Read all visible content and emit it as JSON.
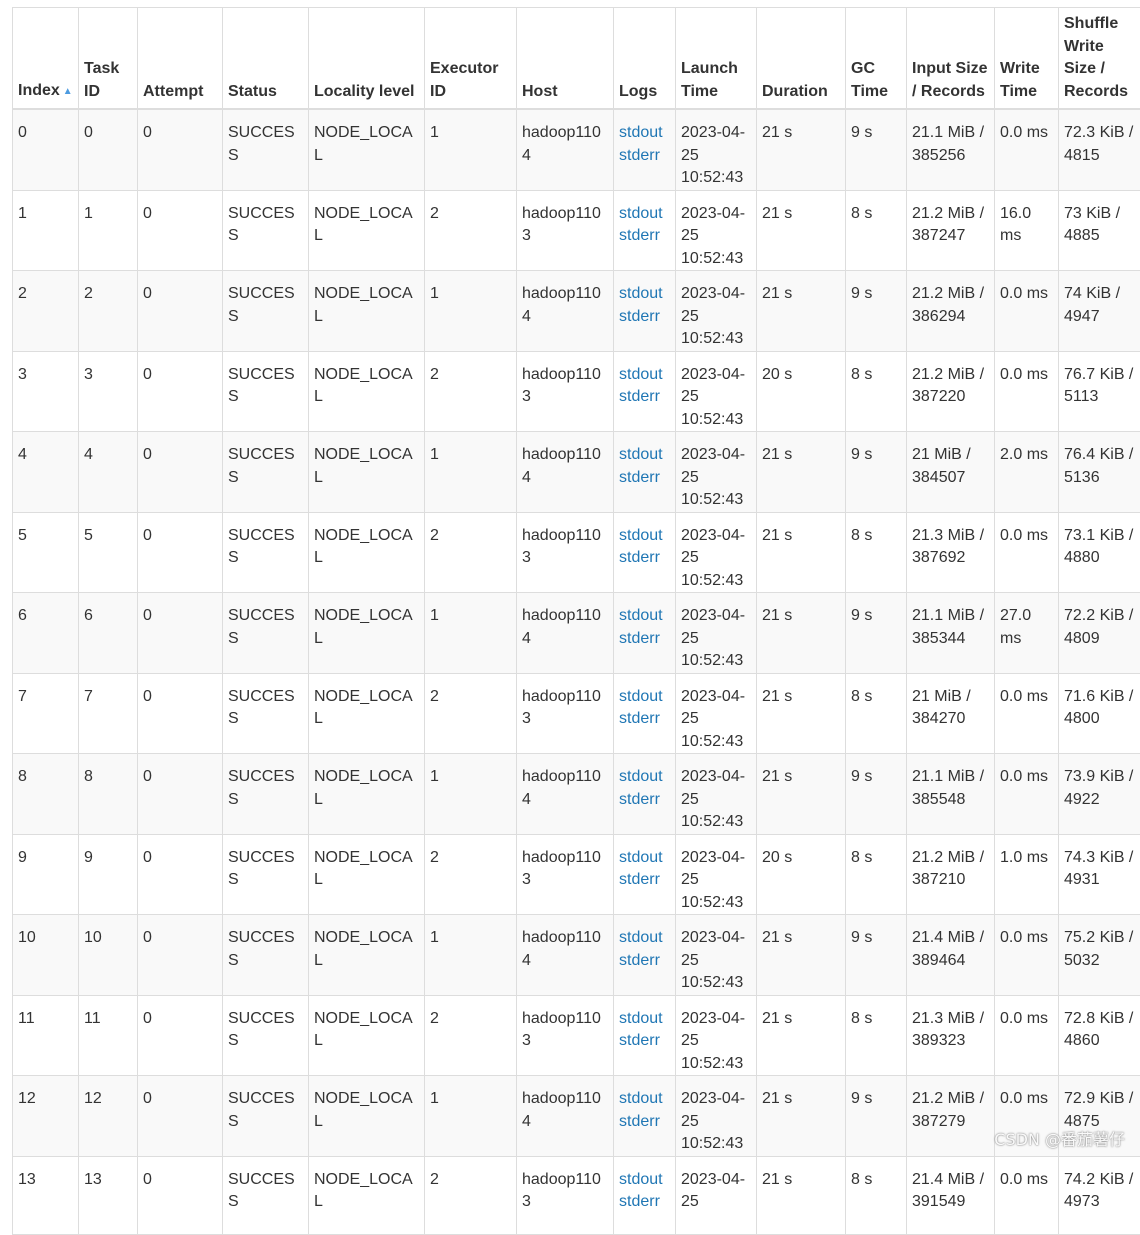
{
  "table": {
    "columns": [
      "Index",
      "Task ID",
      "Attempt",
      "Status",
      "Locality level",
      "Executor ID",
      "Host",
      "Logs",
      "Launch Time",
      "Duration",
      "GC Time",
      "Input Size / Records",
      "Write Time",
      "Shuffle Write Size / Records"
    ],
    "sort_indicator": "▲",
    "rows": [
      {
        "index": "0",
        "task_id": "0",
        "attempt": "0",
        "status": "SUCCESS",
        "locality": "NODE_LOCAL",
        "executor": "1",
        "host": "hadoop1104",
        "stdout": "stdout",
        "stderr": "stderr",
        "launch": "2023-04-25 10:52:43",
        "duration": "21 s",
        "gc": "9 s",
        "input": "21.1 MiB / 385256",
        "write_time": "0.0 ms",
        "shuffle": "72.3 KiB / 4815"
      },
      {
        "index": "1",
        "task_id": "1",
        "attempt": "0",
        "status": "SUCCESS",
        "locality": "NODE_LOCAL",
        "executor": "2",
        "host": "hadoop1103",
        "stdout": "stdout",
        "stderr": "stderr",
        "launch": "2023-04-25 10:52:43",
        "duration": "21 s",
        "gc": "8 s",
        "input": "21.2 MiB / 387247",
        "write_time": "16.0 ms",
        "shuffle": "73 KiB / 4885"
      },
      {
        "index": "2",
        "task_id": "2",
        "attempt": "0",
        "status": "SUCCESS",
        "locality": "NODE_LOCAL",
        "executor": "1",
        "host": "hadoop1104",
        "stdout": "stdout",
        "stderr": "stderr",
        "launch": "2023-04-25 10:52:43",
        "duration": "21 s",
        "gc": "9 s",
        "input": "21.2 MiB / 386294",
        "write_time": "0.0 ms",
        "shuffle": "74 KiB / 4947"
      },
      {
        "index": "3",
        "task_id": "3",
        "attempt": "0",
        "status": "SUCCESS",
        "locality": "NODE_LOCAL",
        "executor": "2",
        "host": "hadoop1103",
        "stdout": "stdout",
        "stderr": "stderr",
        "launch": "2023-04-25 10:52:43",
        "duration": "20 s",
        "gc": "8 s",
        "input": "21.2 MiB / 387220",
        "write_time": "0.0 ms",
        "shuffle": "76.7 KiB / 5113"
      },
      {
        "index": "4",
        "task_id": "4",
        "attempt": "0",
        "status": "SUCCESS",
        "locality": "NODE_LOCAL",
        "executor": "1",
        "host": "hadoop1104",
        "stdout": "stdout",
        "stderr": "stderr",
        "launch": "2023-04-25 10:52:43",
        "duration": "21 s",
        "gc": "9 s",
        "input": "21 MiB / 384507",
        "write_time": "2.0 ms",
        "shuffle": "76.4 KiB / 5136"
      },
      {
        "index": "5",
        "task_id": "5",
        "attempt": "0",
        "status": "SUCCESS",
        "locality": "NODE_LOCAL",
        "executor": "2",
        "host": "hadoop1103",
        "stdout": "stdout",
        "stderr": "stderr",
        "launch": "2023-04-25 10:52:43",
        "duration": "21 s",
        "gc": "8 s",
        "input": "21.3 MiB / 387692",
        "write_time": "0.0 ms",
        "shuffle": "73.1 KiB / 4880"
      },
      {
        "index": "6",
        "task_id": "6",
        "attempt": "0",
        "status": "SUCCESS",
        "locality": "NODE_LOCAL",
        "executor": "1",
        "host": "hadoop1104",
        "stdout": "stdout",
        "stderr": "stderr",
        "launch": "2023-04-25 10:52:43",
        "duration": "21 s",
        "gc": "9 s",
        "input": "21.1 MiB / 385344",
        "write_time": "27.0 ms",
        "shuffle": "72.2 KiB / 4809"
      },
      {
        "index": "7",
        "task_id": "7",
        "attempt": "0",
        "status": "SUCCESS",
        "locality": "NODE_LOCAL",
        "executor": "2",
        "host": "hadoop1103",
        "stdout": "stdout",
        "stderr": "stderr",
        "launch": "2023-04-25 10:52:43",
        "duration": "21 s",
        "gc": "8 s",
        "input": "21 MiB / 384270",
        "write_time": "0.0 ms",
        "shuffle": "71.6 KiB / 4800"
      },
      {
        "index": "8",
        "task_id": "8",
        "attempt": "0",
        "status": "SUCCESS",
        "locality": "NODE_LOCAL",
        "executor": "1",
        "host": "hadoop1104",
        "stdout": "stdout",
        "stderr": "stderr",
        "launch": "2023-04-25 10:52:43",
        "duration": "21 s",
        "gc": "9 s",
        "input": "21.1 MiB / 385548",
        "write_time": "0.0 ms",
        "shuffle": "73.9 KiB / 4922"
      },
      {
        "index": "9",
        "task_id": "9",
        "attempt": "0",
        "status": "SUCCESS",
        "locality": "NODE_LOCAL",
        "executor": "2",
        "host": "hadoop1103",
        "stdout": "stdout",
        "stderr": "stderr",
        "launch": "2023-04-25 10:52:43",
        "duration": "20 s",
        "gc": "8 s",
        "input": "21.2 MiB / 387210",
        "write_time": "1.0 ms",
        "shuffle": "74.3 KiB / 4931"
      },
      {
        "index": "10",
        "task_id": "10",
        "attempt": "0",
        "status": "SUCCESS",
        "locality": "NODE_LOCAL",
        "executor": "1",
        "host": "hadoop1104",
        "stdout": "stdout",
        "stderr": "stderr",
        "launch": "2023-04-25 10:52:43",
        "duration": "21 s",
        "gc": "9 s",
        "input": "21.4 MiB / 389464",
        "write_time": "0.0 ms",
        "shuffle": "75.2 KiB / 5032"
      },
      {
        "index": "11",
        "task_id": "11",
        "attempt": "0",
        "status": "SUCCESS",
        "locality": "NODE_LOCAL",
        "executor": "2",
        "host": "hadoop1103",
        "stdout": "stdout",
        "stderr": "stderr",
        "launch": "2023-04-25 10:52:43",
        "duration": "21 s",
        "gc": "8 s",
        "input": "21.3 MiB / 389323",
        "write_time": "0.0 ms",
        "shuffle": "72.8 KiB / 4860"
      },
      {
        "index": "12",
        "task_id": "12",
        "attempt": "0",
        "status": "SUCCESS",
        "locality": "NODE_LOCAL",
        "executor": "1",
        "host": "hadoop1104",
        "stdout": "stdout",
        "stderr": "stderr",
        "launch": "2023-04-25 10:52:43",
        "duration": "21 s",
        "gc": "9 s",
        "input": "21.2 MiB / 387279",
        "write_time": "0.0 ms",
        "shuffle": "72.9 KiB / 4875"
      },
      {
        "index": "13",
        "task_id": "13",
        "attempt": "0",
        "status": "SUCCESS",
        "locality": "NODE_LOCAL",
        "executor": "2",
        "host": "hadoop1103",
        "stdout": "stdout",
        "stderr": "stderr",
        "launch": "2023-04-25",
        "duration": "21 s",
        "gc": "8 s",
        "input": "21.4 MiB / 391549",
        "write_time": "0.0 ms",
        "shuffle": "74.2 KiB / 4973"
      }
    ]
  },
  "watermark": "CSDN @番茄薯仔"
}
